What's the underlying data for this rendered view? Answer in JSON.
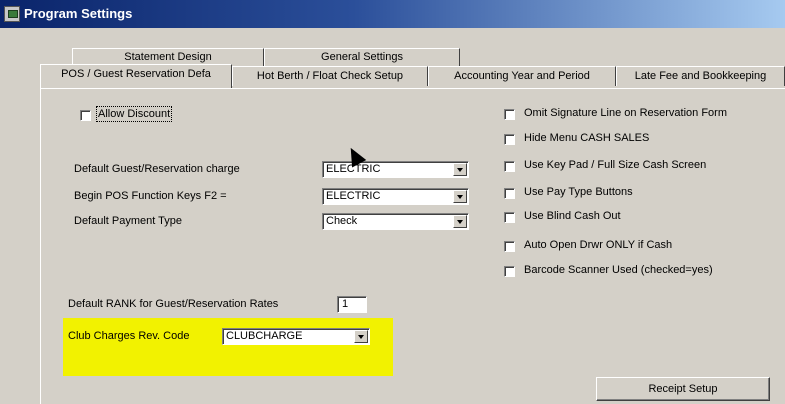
{
  "window": {
    "title": "Program Settings",
    "icon": "app-icon"
  },
  "tabs": {
    "back_row": [
      "Statement Design",
      "General Settings"
    ],
    "front_row": [
      "POS / Guest Reservation Defa",
      "Hot Berth / Float Check Setup",
      "Accounting Year and Period",
      "Late Fee and Bookkeeping"
    ]
  },
  "left": {
    "allow_discount": {
      "label": "Allow Discount",
      "checked": false
    },
    "default_guest_charge": {
      "label": "Default Guest/Reservation charge",
      "value": "ELECTRIC"
    },
    "begin_pos_keys": {
      "label": "Begin POS Function Keys F2 =",
      "value": "ELECTRIC"
    },
    "default_payment": {
      "label": "Default Payment Type",
      "value": "Check"
    },
    "default_rank": {
      "label": "Default RANK for Guest/Reservation Rates",
      "value": "1"
    },
    "club_charges": {
      "label": "Club Charges Rev. Code",
      "value": "CLUBCHARGE"
    }
  },
  "right_checks": [
    {
      "label": "Omit Signature Line on Reservation Form",
      "checked": false
    },
    {
      "label": "Hide Menu CASH SALES",
      "checked": false
    },
    {
      "label": "Use Key Pad / Full Size Cash Screen",
      "checked": false
    },
    {
      "label": "Use  Pay Type Buttons",
      "checked": false
    },
    {
      "label": "Use Blind Cash Out",
      "checked": false
    },
    {
      "label": "Auto Open Drwr ONLY if Cash",
      "checked": false
    },
    {
      "label": "Barcode Scanner Used (checked=yes)",
      "checked": false
    }
  ],
  "buttons": {
    "receipt_setup": "Receipt Setup"
  },
  "colors": {
    "titlebar": "#0a246a",
    "highlight": "#f2f200",
    "face": "#d4d0c8"
  }
}
